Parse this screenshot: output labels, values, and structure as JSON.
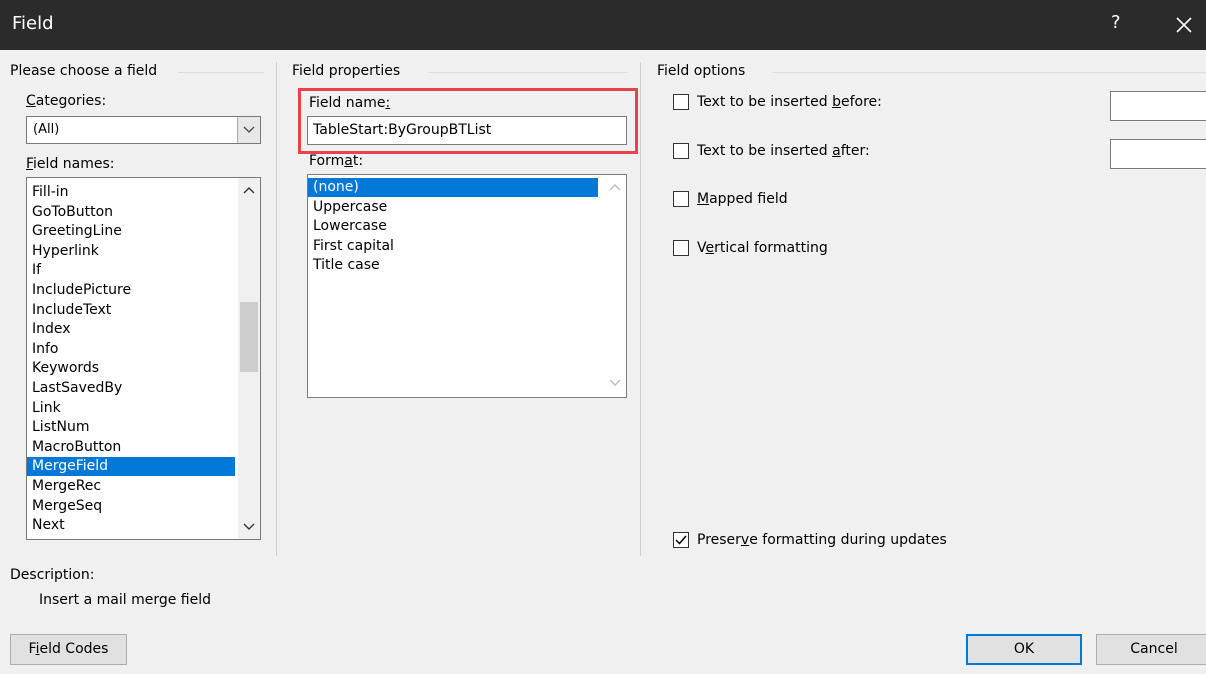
{
  "window": {
    "title": "Field",
    "help_glyph": "?",
    "close_glyph": "✕"
  },
  "choose": {
    "heading": "Please choose a field",
    "categories_label_u": "C",
    "categories_label_rest": "ategories:",
    "categories_value": "(All)",
    "field_names_label_u": "F",
    "field_names_label_rest": "ield names:",
    "field_names": [
      "Fill-in",
      "GoToButton",
      "GreetingLine",
      "Hyperlink",
      "If",
      "IncludePicture",
      "IncludeText",
      "Index",
      "Info",
      "Keywords",
      "LastSavedBy",
      "Link",
      "ListNum",
      "MacroButton",
      "MergeField",
      "MergeRec",
      "MergeSeq",
      "Next"
    ],
    "selected_field": "MergeField"
  },
  "properties": {
    "heading": "Field properties",
    "field_name_label": "Field name",
    "field_name_label_u": ":",
    "field_name_value": "TableStart:ByGroupBTList",
    "format_label_pre": "Form",
    "format_label_u": "a",
    "format_label_post": "t:",
    "formats": [
      "(none)",
      "Uppercase",
      "Lowercase",
      "First capital",
      "Title case"
    ],
    "selected_format": "(none)",
    "highlight_color": "#e8434a"
  },
  "options": {
    "heading": "Field options",
    "before_pre": "Text to be inserted ",
    "before_u": "b",
    "before_post": "efore:",
    "before_checked": false,
    "before_value": "",
    "after_pre": "Text to be inserted ",
    "after_u": "a",
    "after_post": "fter:",
    "after_checked": false,
    "after_value": "",
    "mapped_u": "M",
    "mapped_rest": "apped field",
    "mapped_checked": false,
    "vertical_pre": "V",
    "vertical_u": "e",
    "vertical_post": "rtical formatting",
    "vertical_checked": false,
    "preserve_pre": "Preser",
    "preserve_u": "v",
    "preserve_post": "e formatting during updates",
    "preserve_checked": true
  },
  "description": {
    "label": "Description:",
    "text": "Insert a mail merge field"
  },
  "buttons": {
    "field_codes_pre": "F",
    "field_codes_u": "i",
    "field_codes_post": "eld Codes",
    "ok": "OK",
    "cancel": "Cancel"
  },
  "colors": {
    "selection": "#0078d7",
    "titlebar": "#2b2b2b"
  }
}
